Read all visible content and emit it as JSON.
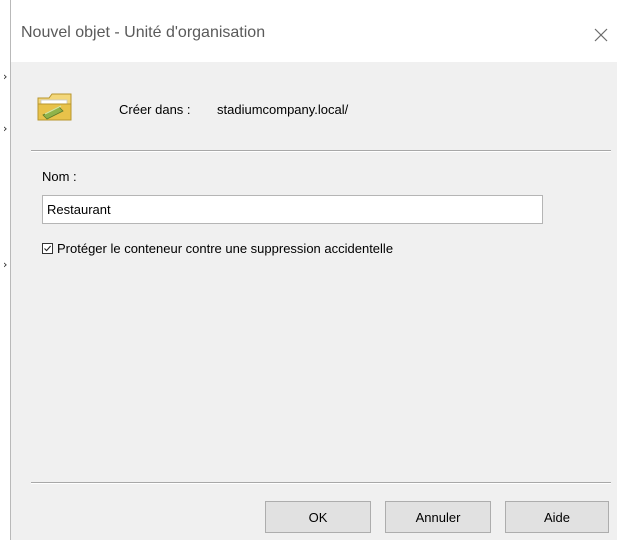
{
  "dialog": {
    "title": "Nouvel objet - Unité d'organisation",
    "close_icon": "close-icon",
    "create_in_label": "Créer dans :",
    "create_in_path": "stadiumcompany.local/",
    "folder_icon": "folder-icon",
    "name_label": "Nom :",
    "name_value": "Restaurant",
    "protect_checked": true,
    "protect_label": "Protéger le conteneur contre une suppression accidentelle",
    "buttons": {
      "ok": "OK",
      "cancel": "Annuler",
      "help": "Aide"
    }
  },
  "colors": {
    "dialog_bg": "#f0f0f0",
    "title_bg": "#ffffff",
    "button_bg": "#e1e1e1",
    "button_border": "#adadad",
    "folder_yellow": "#e8c24a"
  }
}
